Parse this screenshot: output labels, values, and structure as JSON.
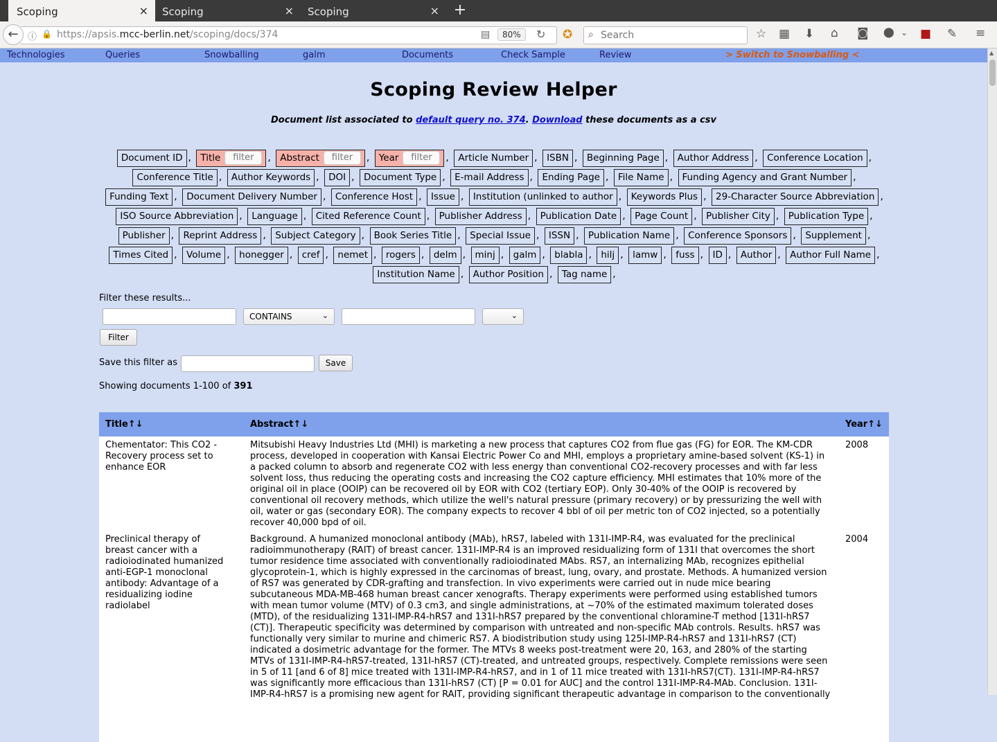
{
  "browser": {
    "tabs": [
      {
        "label": "Scoping",
        "active": true
      },
      {
        "label": "Scoping",
        "active": false
      },
      {
        "label": "Scoping",
        "active": false
      }
    ],
    "url_prefix": "https://apsis.",
    "url_domain": "mcc-berlin.net",
    "url_path": "/scoping/docs/374",
    "zoom": "80%",
    "search_placeholder": "Search"
  },
  "menu": {
    "items": [
      "Technologies",
      "Queries",
      "Snowballing",
      "galm",
      "Documents",
      "Check Sample",
      "Review"
    ],
    "switch": "> Switch to Snowballing <"
  },
  "page": {
    "title": "Scoping Review Helper",
    "subtitle_1": "Document list associated to ",
    "subtitle_link_1": "default query no. 374",
    "subtitle_2": ". ",
    "subtitle_link_2": "Download",
    "subtitle_3": " these documents as a csv"
  },
  "fields": [
    {
      "label": "Document ID"
    },
    {
      "label": "Title",
      "active": true,
      "filter_placeholder": "filter"
    },
    {
      "label": "Abstract",
      "active": true,
      "filter_placeholder": "filter"
    },
    {
      "label": "Year",
      "active": true,
      "filter_placeholder": "filter"
    },
    {
      "label": "Article Number"
    },
    {
      "label": "ISBN"
    },
    {
      "label": "Beginning Page"
    },
    {
      "label": "Author Address"
    },
    {
      "label": "Conference Location"
    },
    {
      "label": "Conference Title"
    },
    {
      "label": "Author Keywords"
    },
    {
      "label": "DOI"
    },
    {
      "label": "Document Type"
    },
    {
      "label": "E-mail Address"
    },
    {
      "label": "Ending Page"
    },
    {
      "label": "File Name"
    },
    {
      "label": "Funding Agency and Grant Number"
    },
    {
      "label": "Funding Text"
    },
    {
      "label": "Document Delivery Number"
    },
    {
      "label": "Conference Host"
    },
    {
      "label": "Issue"
    },
    {
      "label": "Institution (unlinked to author"
    },
    {
      "label": "Keywords Plus"
    },
    {
      "label": "29-Character Source Abbreviation"
    },
    {
      "label": "ISO Source Abbreviation"
    },
    {
      "label": "Language"
    },
    {
      "label": "Cited Reference Count"
    },
    {
      "label": "Publisher Address"
    },
    {
      "label": "Publication Date"
    },
    {
      "label": "Page Count"
    },
    {
      "label": "Publisher City"
    },
    {
      "label": "Publication Type"
    },
    {
      "label": "Publisher"
    },
    {
      "label": "Reprint Address"
    },
    {
      "label": "Subject Category"
    },
    {
      "label": "Book Series Title"
    },
    {
      "label": "Special Issue"
    },
    {
      "label": "ISSN"
    },
    {
      "label": "Publication Name"
    },
    {
      "label": "Conference Sponsors"
    },
    {
      "label": "Supplement"
    },
    {
      "label": "Times Cited"
    },
    {
      "label": "Volume"
    },
    {
      "label": "honegger"
    },
    {
      "label": "cref"
    },
    {
      "label": "nemet"
    },
    {
      "label": "rogers"
    },
    {
      "label": "delm"
    },
    {
      "label": "minj"
    },
    {
      "label": "galm"
    },
    {
      "label": "blabla"
    },
    {
      "label": "hilj"
    },
    {
      "label": "lamw"
    },
    {
      "label": "fuss"
    },
    {
      "label": "ID"
    },
    {
      "label": "Author"
    },
    {
      "label": "Author Full Name"
    },
    {
      "label": "Institution Name"
    },
    {
      "label": "Author Position"
    },
    {
      "label": "Tag name"
    }
  ],
  "filter": {
    "label": "Filter these results...",
    "field_value": "",
    "operator": "CONTAINS",
    "value": "",
    "extra_select": "",
    "button": "Filter",
    "save_label": "Save this filter as",
    "save_value": "",
    "save_button": "Save"
  },
  "results": {
    "showing_prefix": "Showing documents 1-100 of ",
    "total": "391"
  },
  "table": {
    "columns": [
      "Title",
      "Abstract",
      "Year"
    ],
    "sort_glyph": "↑↓",
    "rows": [
      {
        "title": "Chementator: This CO2 -Recovery process set to enhance EOR",
        "abstract": "Mitsubishi Heavy Industries Ltd (MHI) is marketing a new process that captures CO2 from flue gas (FG) for EOR. The KM-CDR process, developed in cooperation with Kansai Electric Power Co and MHI, employs a proprietary amine-based solvent (KS-1) in a packed column to absorb and regenerate CO2 with less energy than conventional CO2-recovery processes and with far less solvent loss, thus reducing the operating costs and increasing the CO2 capture efficiency. MHI estimates that 10% more of the original oil in place (OOIP) can be recovered oil by EOR with CO2 (tertiary EOP). Only 30-40% of the OOIP is recovered by conventional oil recovery methods, which utilize the well's natural pressure (primary recovery) or by pressurizing the well with oil, water or gas (secondary EOR). The company expects to recover 4 bbl of oil per metric ton of CO2 injected, so a potentially recover 40,000 bpd of oil.",
        "year": "2008"
      },
      {
        "title": "Preclinical therapy of breast cancer with a radioiodinated humanized anti-EGP-1 monoclonal antibody: Advantage of a residualizing iodine radiolabel",
        "abstract": "Background. A humanized monoclonal antibody (MAb), hRS7, labeled with 131I-IMP-R4, was evaluated for the preclinical radioimmunotherapy (RAIT) of breast cancer. 131I-IMP-R4 is an improved residualizing form of 131I that overcomes the short tumor residence time associated with conventionally radioiodinated MAbs. RS7, an internalizing MAb, recognizes epithelial glycoprotein-1, which is highly expressed in the carcinomas of breast, lung, ovary, and prostate. Methods. A humanized version of RS7 was generated by CDR-grafting and transfection. In vivo experiments were carried out in nude mice bearing subcutaneous MDA-MB-468 human breast cancer xenografts. Therapy experiments were performed using established tumors with mean tumor volume (MTV) of 0.3 cm3, and single administrations, at ~70% of the estimated maximum tolerated doses (MTD), of the residualizing 131I-IMP-R4-hRS7 and 131I-hRS7 prepared by the conventional chloramine-T method [131I-hRS7 (CT)]. Therapeutic specificity was determined by comparison with untreated and non-specific MAb controls. Results. hRS7 was functionally very similar to murine and chimeric RS7. A biodistribution study using 125I-IMP-R4-hRS7 and 131I-hRS7 (CT) indicated a dosimetric advantage for the former. The MTVs 8 weeks post-treatment were 20, 163, and 280% of the starting MTVs of 131I-IMP-R4-hRS7-treated, 131I-hRS7 (CT)-treated, and untreated groups, respectively. Complete remissions were seen in 5 of 11 [and 6 of 8] mice treated with 131I-IMP-R4-hRS7, and in 1 of 11 mice treated with 131I-hRS7(CT). 131I-IMP-R4-hRS7 was significantly more efficacious than 131I-hRS7 (CT) [P = 0.01 for AUC] and the control 131I-IMP-R4-MAb. Conclusion. 131I-IMP-R4-hRS7 is a promising new agent for RAIT, providing significant therapeutic advantage in comparison to the conventionally",
        "year": "2004"
      }
    ]
  }
}
